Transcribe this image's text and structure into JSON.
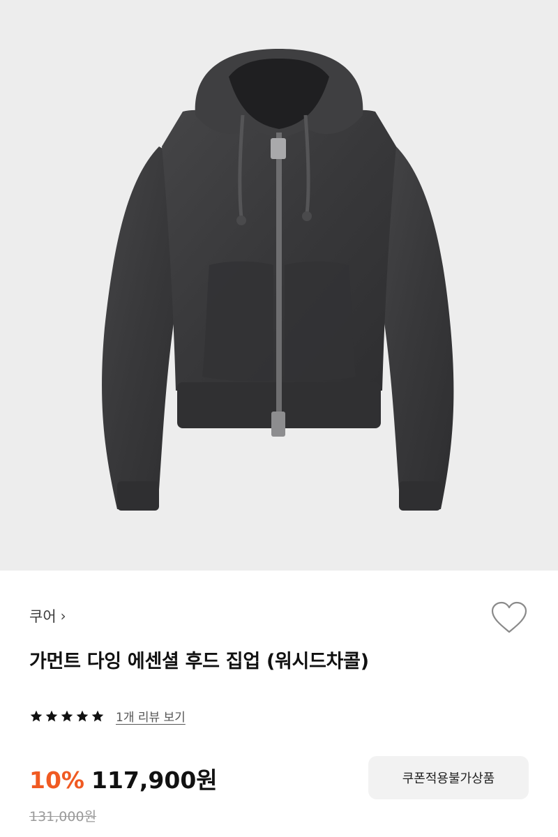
{
  "product": {
    "image_alt": "garment-dyed hooded zip-up jacket, washed charcoal",
    "brand": "쿠어",
    "title": "가먼트 다잉 에센셜 후드 집업 (워시드차콜)",
    "rating_stars": 5,
    "review_link": "1개 리뷰 보기",
    "discount": "10%",
    "price": "117,900원",
    "original_price": "131,000원",
    "coupon_button": "쿠폰적용불가상품"
  },
  "icons": {
    "brand_chevron": "chevron-right-icon",
    "wishlist": "heart-outline-icon",
    "star": "star-filled-icon"
  },
  "colors": {
    "discount": "#f05a22",
    "hero_background": "#ededed",
    "garment": "#3b3b3d",
    "coupon_button_bg": "#f2f2f2"
  }
}
